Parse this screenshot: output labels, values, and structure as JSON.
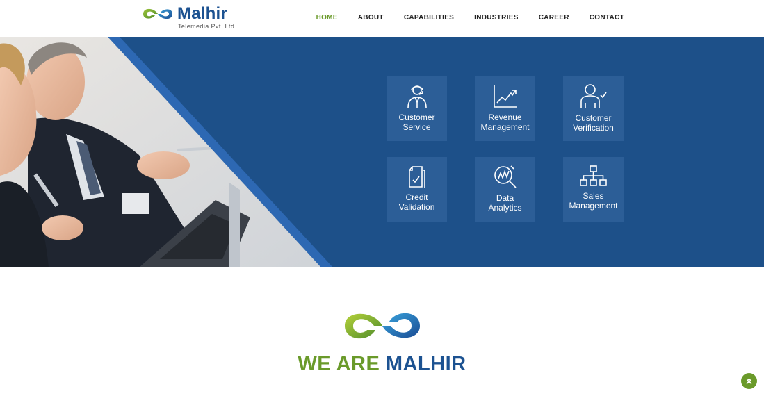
{
  "brand": {
    "name": "Malhir",
    "subtitle": "Telemedia Pvt. Ltd",
    "colors": {
      "green": "#6a9a2a",
      "blue": "#1c5291",
      "banner": "#1d5089",
      "card": "#2c5e97"
    }
  },
  "nav": {
    "items": [
      {
        "label": "HOME",
        "active": true
      },
      {
        "label": "ABOUT",
        "active": false
      },
      {
        "label": "CAPABILITIES",
        "active": false
      },
      {
        "label": "INDUSTRIES",
        "active": false
      },
      {
        "label": "CAREER",
        "active": false
      },
      {
        "label": "CONTACT",
        "active": false
      }
    ]
  },
  "services": [
    {
      "line1": "Customer",
      "line2": "Service",
      "icon": "headset-agent-icon"
    },
    {
      "line1": "Revenue",
      "line2": "Management",
      "icon": "line-chart-icon"
    },
    {
      "line1": "Customer",
      "line2": "Verification",
      "icon": "user-check-icon"
    },
    {
      "line1": "Credit",
      "line2": "Validation",
      "icon": "document-check-icon"
    },
    {
      "line1": "Data",
      "line2": "Analytics",
      "icon": "magnifier-chart-icon"
    },
    {
      "line1": "Sales",
      "line2": "Management",
      "icon": "org-chart-icon"
    }
  ],
  "intro": {
    "title_part1": "WE ARE ",
    "title_part2": "MALHIR"
  },
  "scroll_top": {
    "icon": "double-chevron-up-icon"
  }
}
